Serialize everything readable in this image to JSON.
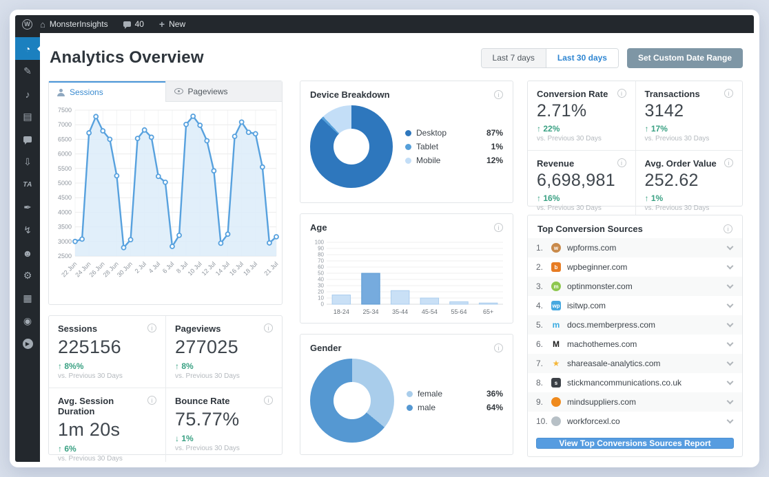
{
  "admin_bar": {
    "site_name": "MonsterInsights",
    "comments_count": "40",
    "new_label": "New"
  },
  "sidebar": {
    "items": [
      {
        "name": "monsterinsights-dashboard-icon",
        "glyph": "◔",
        "active": true
      },
      {
        "name": "posts-pin-icon",
        "glyph": "✎"
      },
      {
        "name": "media-icon",
        "glyph": "♪"
      },
      {
        "name": "pages-icon",
        "glyph": "▤"
      },
      {
        "name": "comments-icon",
        "glyph": "",
        "shape": "bubble"
      },
      {
        "name": "downloads-icon",
        "glyph": "⇩"
      },
      {
        "name": "ta-plugin-icon",
        "glyph": "TA",
        "text": true
      },
      {
        "name": "appearance-brush-icon",
        "glyph": "✒"
      },
      {
        "name": "plugins-icon",
        "glyph": "↯"
      },
      {
        "name": "users-icon",
        "glyph": "☻"
      },
      {
        "name": "tools-wrench-icon",
        "glyph": "⚙"
      },
      {
        "name": "settings-box-icon",
        "glyph": "▦"
      },
      {
        "name": "addons-gear-icon",
        "glyph": "◉"
      },
      {
        "name": "video-play-icon",
        "glyph": "▶",
        "shape": "play"
      }
    ]
  },
  "header": {
    "title": "Analytics Overview",
    "range_7": "Last 7 days",
    "range_30": "Last 30 days",
    "custom_range": "Set Custom Date Range"
  },
  "tabs": {
    "sessions": "Sessions",
    "pageviews": "Pageviews"
  },
  "chart_data": [
    {
      "type": "area",
      "title": "Sessions",
      "ylim": [
        2500,
        7500
      ],
      "ytick_step": 500,
      "values": [
        3000,
        3080,
        6720,
        7280,
        6790,
        6500,
        5250,
        2790,
        3060,
        6530,
        6820,
        6570,
        5230,
        5030,
        2830,
        3210,
        7010,
        7290,
        6980,
        6450,
        5420,
        2940,
        3250,
        6600,
        7090,
        6740,
        6690,
        5550,
        2950,
        3160
      ],
      "x_tick_indices": [
        0,
        2,
        4,
        6,
        8,
        10,
        12,
        14,
        16,
        18,
        20,
        22,
        24,
        26,
        29
      ],
      "x_tick_labels": [
        "22 Jun",
        "24 Jun",
        "26 Jun",
        "28 Jun",
        "30 Jun",
        "2 Jul",
        "4 Jul",
        "6 Jul",
        "8 Jul",
        "10 Jul",
        "12 Jul",
        "14 Jul",
        "16 Jul",
        "18 Jul",
        "21 Jul"
      ],
      "line_color": "#57a1de",
      "fill_color": "#dcecf9",
      "grid": true,
      "legend_position": "none"
    },
    {
      "type": "pie",
      "title": "Device Breakdown",
      "items": [
        {
          "label": "Desktop",
          "value": 87,
          "display": "87%",
          "color": "#2e77bd"
        },
        {
          "label": "Tablet",
          "value": 1,
          "display": "1%",
          "color": "#56a0da"
        },
        {
          "label": "Mobile",
          "value": 12,
          "display": "12%",
          "color": "#c3def7"
        }
      ],
      "legend_position": "right"
    },
    {
      "type": "bar",
      "title": "Age",
      "categories": [
        "18-24",
        "25-34",
        "35-44",
        "45-54",
        "55-64",
        "65+"
      ],
      "values": [
        15,
        50,
        22,
        10,
        4,
        2
      ],
      "ylim": [
        0,
        100
      ],
      "ytick_step": 10,
      "bar_color": "#c9e0f6",
      "bar_border": "#aacdee",
      "highlight_index": 1,
      "highlight_color": "#76abde",
      "highlight_border": "#5d9bd3",
      "grid": true,
      "legend_position": "none"
    },
    {
      "type": "pie",
      "title": "Gender",
      "items": [
        {
          "label": "female",
          "value": 36,
          "display": "36%",
          "color": "#a9cdeb"
        },
        {
          "label": "male",
          "value": 64,
          "display": "64%",
          "color": "#5598d2"
        }
      ],
      "legend_position": "right"
    }
  ],
  "metrics": {
    "sessions": {
      "title": "Sessions",
      "value": "225156",
      "arrow": "↑",
      "delta": "8%%",
      "compare": "vs. Previous 30 Days"
    },
    "pageviews": {
      "title": "Pageviews",
      "value": "277025",
      "arrow": "↑",
      "delta": "8%",
      "compare": "vs. Previous 30 Days"
    },
    "duration": {
      "title": "Avg. Session Duration",
      "value": "1m 20s",
      "arrow": "↑",
      "delta": "6%",
      "compare": "vs. Previous 30 Days"
    },
    "bounce": {
      "title": "Bounce Rate",
      "value": "75.77%",
      "arrow": "↓",
      "delta": "1%",
      "compare": "vs. Previous 30 Days"
    }
  },
  "ecommerce": {
    "conversion": {
      "title": "Conversion Rate",
      "value": "2.71%",
      "arrow": "↑",
      "delta": "22%",
      "compare": "vs. Previous 30 Days"
    },
    "transactions": {
      "title": "Transactions",
      "value": "3142",
      "arrow": "↑",
      "delta": "17%",
      "compare": "vs. Previous 30 Days"
    },
    "revenue": {
      "title": "Revenue",
      "value": "6,698,981",
      "arrow": "↑",
      "delta": "16%",
      "compare": "vs. Previous 30 Days"
    },
    "aov": {
      "title": "Avg. Order Value",
      "value": "252.62",
      "arrow": "↑",
      "delta": "1%",
      "compare": "vs. Previous 30 Days"
    }
  },
  "sources": {
    "title": "Top Conversion Sources",
    "button_label": "View Top Conversions Sources Report",
    "items": [
      {
        "rank": "1.",
        "domain": "wpforms.com",
        "icon": "wpforms-favicon",
        "fav": {
          "bg": "#c98a4b",
          "fg": "#ffffff",
          "text": "w",
          "shape": "circle"
        }
      },
      {
        "rank": "2.",
        "domain": "wpbeginner.com",
        "icon": "wpbeginner-favicon",
        "fav": {
          "bg": "#e77c23",
          "fg": "#ffffff",
          "text": "b",
          "shape": "square"
        }
      },
      {
        "rank": "3.",
        "domain": "optinmonster.com",
        "icon": "optinmonster-favicon",
        "fav": {
          "bg": "#8ec74f",
          "fg": "#ffffff",
          "text": "m",
          "shape": "circle"
        }
      },
      {
        "rank": "4.",
        "domain": "isitwp.com",
        "icon": "isitwp-favicon",
        "fav": {
          "bg": "#46a8e0",
          "fg": "#ffffff",
          "text": "wp",
          "shape": "square"
        }
      },
      {
        "rank": "5.",
        "domain": "docs.memberpress.com",
        "icon": "memberpress-favicon",
        "fav": {
          "bg": "transparent",
          "fg": "#36a9e1",
          "text": "m",
          "shape": "text"
        }
      },
      {
        "rank": "6.",
        "domain": "machothemes.com",
        "icon": "machothemes-favicon",
        "fav": {
          "bg": "transparent",
          "fg": "#1a1a1a",
          "text": "M",
          "shape": "text"
        }
      },
      {
        "rank": "7.",
        "domain": "shareasale-analytics.com",
        "icon": "shareasale-favicon",
        "fav": {
          "bg": "transparent",
          "fg": "#f5b73a",
          "text": "★",
          "shape": "text"
        }
      },
      {
        "rank": "8.",
        "domain": "stickmancommunications.co.uk",
        "icon": "stickman-favicon",
        "fav": {
          "bg": "#3b4046",
          "fg": "#ffffff",
          "text": "s",
          "shape": "square"
        }
      },
      {
        "rank": "9.",
        "domain": "mindsuppliers.com",
        "icon": "mindsuppliers-favicon",
        "fav": {
          "bg": "#ef8a1d",
          "fg": "#ffffff",
          "text": "",
          "shape": "circle"
        }
      },
      {
        "rank": "10.",
        "domain": "workforcexl.co",
        "icon": "workforcexl-favicon",
        "fav": {
          "bg": "#b7c0c6",
          "fg": "#ffffff",
          "text": "",
          "shape": "circle"
        }
      }
    ]
  }
}
